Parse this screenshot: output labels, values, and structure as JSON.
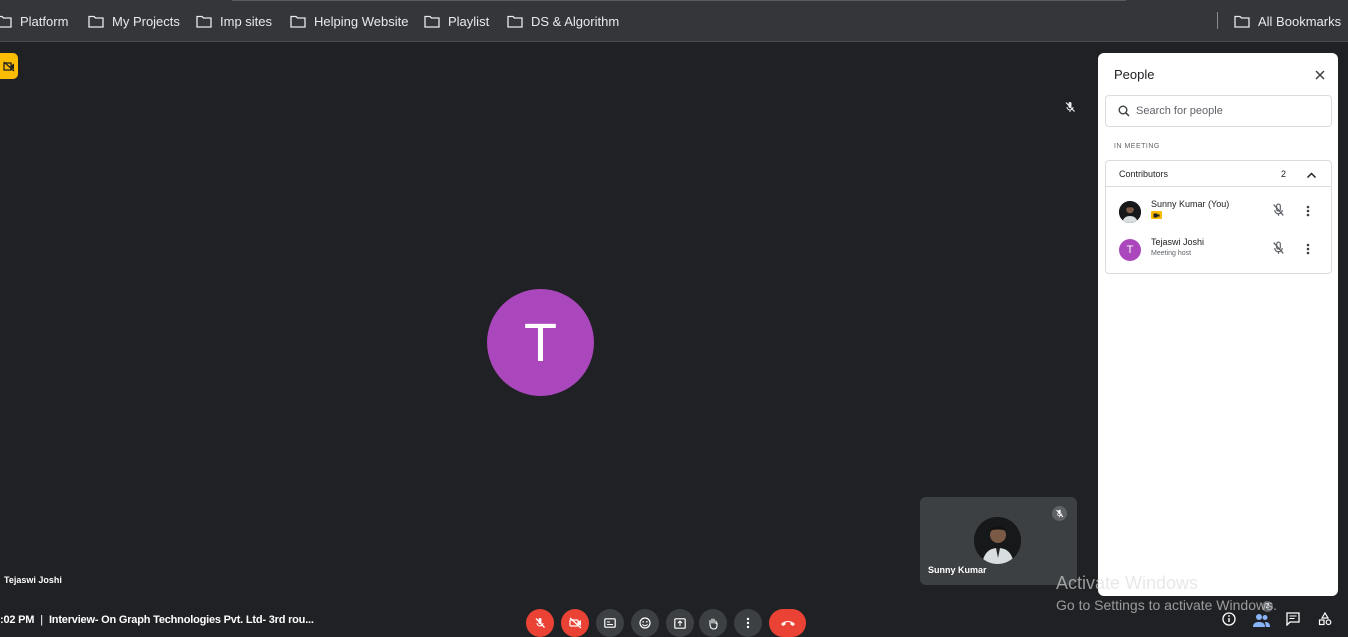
{
  "bookmarks": {
    "items": [
      {
        "label": "Platform"
      },
      {
        "label": "My Projects"
      },
      {
        "label": "Imp sites"
      },
      {
        "label": "Helping Website"
      },
      {
        "label": "Playlist"
      },
      {
        "label": "DS & Algorithm"
      }
    ],
    "all_bookmarks": "All Bookmarks"
  },
  "stage": {
    "main_avatar_letter": "T",
    "main_name": "Tejaswi Joshi",
    "self_name": "Sunny Kumar"
  },
  "meeting": {
    "time": ":02 PM",
    "separator": "|",
    "title": "Interview- On Graph Technologies Pvt. Ltd- 3rd rou..."
  },
  "people_panel": {
    "title": "People",
    "search_placeholder": "Search for people",
    "section_label": "IN MEETING",
    "group_label": "Contributors",
    "group_count": "2",
    "people": [
      {
        "name": "Sunny Kumar (You)",
        "subtitle": ""
      },
      {
        "name": "Tejaswi Joshi",
        "subtitle": "Meeting host",
        "avatar_letter": "T"
      }
    ],
    "participant_badge": "2"
  },
  "watermark": {
    "line1": "Activate Windows",
    "line2": "Go to Settings to activate Windows."
  },
  "colors": {
    "stage_bg": "#202124",
    "avatar_purple": "#ab47bc",
    "danger_red": "#ea4335",
    "recording_yellow": "#fbbc04"
  }
}
